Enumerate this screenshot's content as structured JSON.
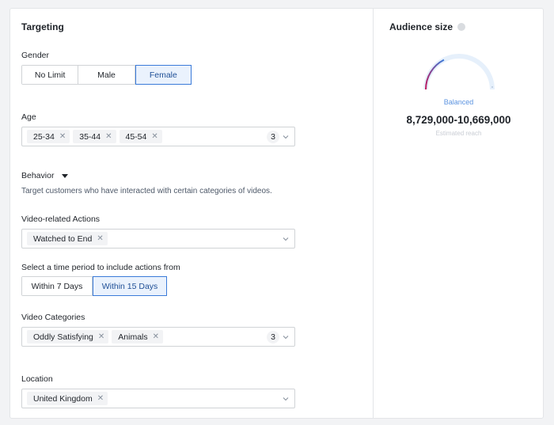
{
  "targeting": {
    "title": "Targeting",
    "gender": {
      "label": "Gender",
      "options": [
        "No Limit",
        "Male",
        "Female"
      ],
      "selected": "Female"
    },
    "age": {
      "label": "Age",
      "tags": [
        "25-34",
        "35-44",
        "45-54"
      ],
      "count": "3"
    },
    "behavior": {
      "label": "Behavior",
      "description": "Target customers who have interacted with certain categories of videos."
    },
    "video_actions": {
      "label": "Video-related Actions",
      "tags": [
        "Watched to End"
      ]
    },
    "time_period": {
      "label": "Select a time period to include actions from",
      "options": [
        "Within 7 Days",
        "Within 15 Days"
      ],
      "selected": "Within 15 Days"
    },
    "video_categories": {
      "label": "Video Categories",
      "tags": [
        "Oddly Satisfying",
        "Animals"
      ],
      "count": "3"
    },
    "location": {
      "label": "Location",
      "tags": [
        "United Kingdom"
      ]
    }
  },
  "audience": {
    "title": "Audience size",
    "status": "Balanced",
    "range": "8,729,000-10,669,000",
    "caption": "Estimated reach",
    "gauge_level": 0.35,
    "colors": {
      "accent": "#3b7bd9",
      "status": "#5b93e0",
      "gauge_start": "#c2185b"
    }
  }
}
